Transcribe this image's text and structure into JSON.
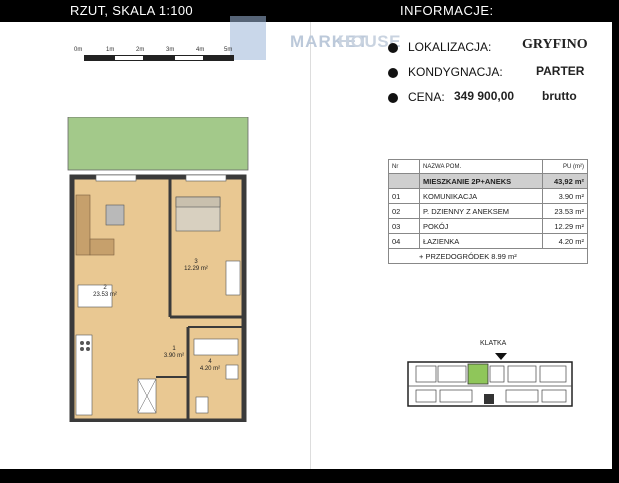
{
  "header": {
    "left": "RZUT, SKALA 1:100",
    "right": "INFORMACJE:"
  },
  "logo": {
    "text1": "MARKET",
    "text2": "HOUSE"
  },
  "scale_bar": {
    "labels": [
      "0m",
      "1m",
      "2m",
      "3m",
      "4m",
      "5m"
    ]
  },
  "info": {
    "lokalizacja_label": "LOKALIZACJA:",
    "lokalizacja_value": "GRYFINO",
    "kondygnacja_label": "KONDYGNACJA:",
    "kondygnacja_value": "PARTER",
    "cena_label": "CENA:",
    "cena_value": "349 900,00",
    "cena_suffix": "brutto"
  },
  "rooms_table": {
    "headers": [
      "Nr",
      "NAZWA POM.",
      "PU (m²)"
    ],
    "summary": {
      "name": "MIESZKANIE 2P+ANEKS",
      "value": "43,92 m²"
    },
    "rows": [
      {
        "nr": "01",
        "name": "KOMUNIKACJA",
        "value": "3.90 m²"
      },
      {
        "nr": "02",
        "name": "P. DZIENNY Z ANEKSEM",
        "value": "23.53 m²"
      },
      {
        "nr": "03",
        "name": "POKÓJ",
        "value": "12.29 m²"
      },
      {
        "nr": "04",
        "name": "ŁAZIENKA",
        "value": "4.20 m²"
      }
    ],
    "footer": "+ PRZEDOGRÓDEK 8.99 m²"
  },
  "keyplan": {
    "label": "KLATKA"
  },
  "plan": {
    "room2": {
      "nr": "2",
      "area": "23.53 m²"
    },
    "room3": {
      "nr": "3",
      "area": "12.29 m²"
    },
    "room1": {
      "nr": "1",
      "area": "3.90 m²"
    },
    "room4": {
      "nr": "4",
      "area": "4.20 m²"
    }
  },
  "colors": {
    "garden": "#a3c98a",
    "floor": "#e9c892",
    "wall": "#3a3a3a",
    "highlight": "#cfcfcf",
    "keyplan_unit": "#8fc65a"
  }
}
